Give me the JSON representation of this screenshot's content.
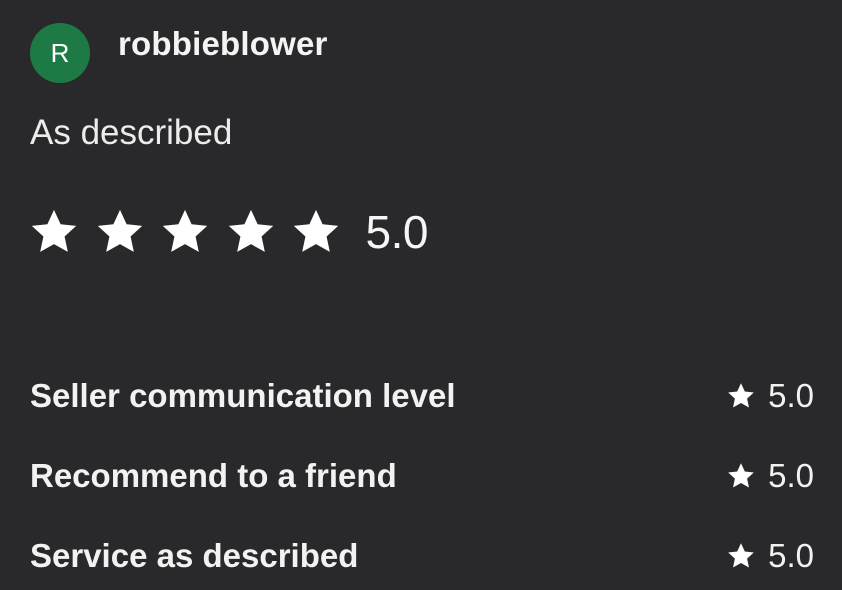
{
  "review": {
    "user": {
      "avatar_initial": "R",
      "avatar_color": "#1e7a45",
      "username": "robbieblower"
    },
    "text": "As described",
    "overall_rating": {
      "value": 5.0,
      "max": 5,
      "display": "5.0",
      "star_icon": "star-icon"
    },
    "criteria": [
      {
        "label": "Seller communication level",
        "score": "5.0"
      },
      {
        "label": "Recommend to a friend",
        "score": "5.0"
      },
      {
        "label": "Service as described",
        "score": "5.0"
      }
    ]
  },
  "colors": {
    "background": "#29292c",
    "text": "#f2f2f2",
    "star": "#ffffff"
  }
}
